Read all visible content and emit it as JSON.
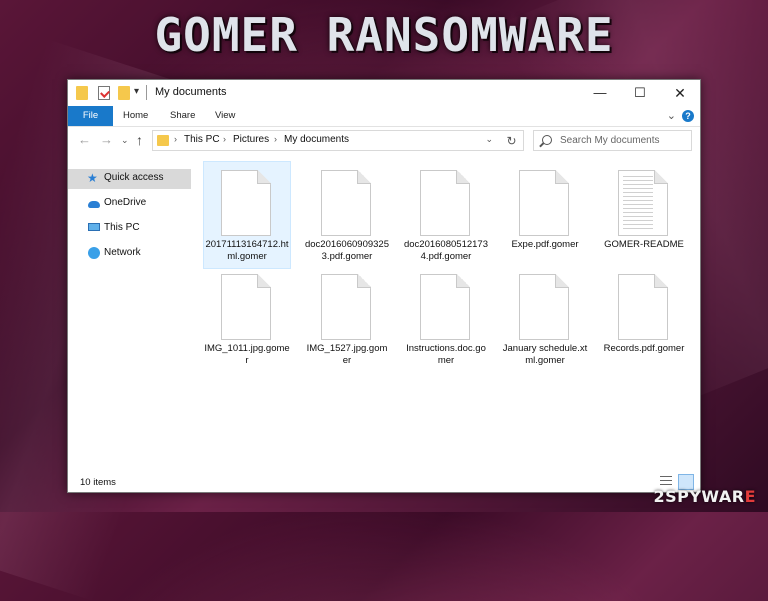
{
  "banner": {
    "title": "GOMER RANSOMWARE"
  },
  "window": {
    "title": "My documents",
    "controls": {
      "minimize": "—",
      "maximize": "☐",
      "close": "✕"
    }
  },
  "ribbon": {
    "tabs": [
      "File",
      "Home",
      "Share",
      "View"
    ],
    "help": "?"
  },
  "address": {
    "crumbs": [
      "This PC",
      "Pictures",
      "My documents"
    ],
    "separator": "›"
  },
  "search": {
    "placeholder": "Search My documents"
  },
  "sidebar": {
    "items": [
      {
        "label": "Quick access",
        "icon": "star-icon",
        "selected": true
      },
      {
        "label": "OneDrive",
        "icon": "cloud-icon"
      },
      {
        "label": "This PC",
        "icon": "computer-icon"
      },
      {
        "label": "Network",
        "icon": "network-icon"
      }
    ]
  },
  "files": [
    {
      "name": "20171113164712.html.gomer"
    },
    {
      "name": "doc20160609093253.pdf.gomer"
    },
    {
      "name": "doc20160805121734.pdf.gomer"
    },
    {
      "name": "Expe.pdf.gomer"
    },
    {
      "name": "GOMER-README"
    },
    {
      "name": "IMG_1011.jpg.gomer"
    },
    {
      "name": "IMG_1527.jpg.gomer"
    },
    {
      "name": "Instructions.doc.gomer"
    },
    {
      "name": "January schedule.xtml.gomer"
    },
    {
      "name": "Records.pdf.gomer"
    }
  ],
  "status": {
    "count": "10 items"
  },
  "watermark": {
    "prefix": "2",
    "brand": "SPYWAR",
    "suffix": "E"
  },
  "colors": {
    "accent": "#1979ca",
    "folder": "#f5c84c",
    "background": "#4a1230"
  }
}
